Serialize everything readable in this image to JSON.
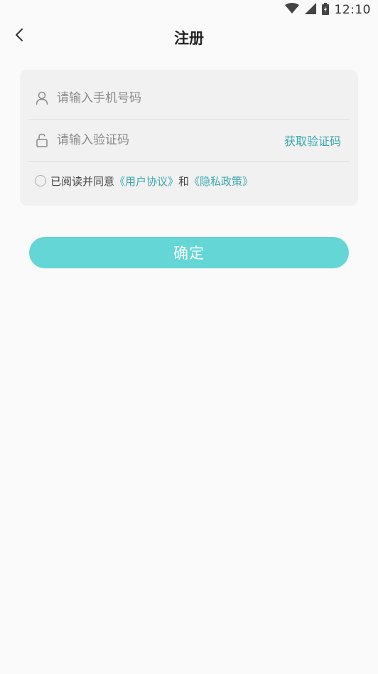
{
  "status_bar": {
    "time": "12:10",
    "icons": [
      "wifi-icon",
      "signal-icon",
      "battery-icon"
    ]
  },
  "header": {
    "title": "注册",
    "back_icon": "chevron-left-icon"
  },
  "form": {
    "phone": {
      "icon": "user-icon",
      "placeholder": "请输入手机号码",
      "value": ""
    },
    "code": {
      "icon": "lock-icon",
      "placeholder": "请输入验证码",
      "value": "",
      "get_code_label": "获取验证码"
    },
    "agreement": {
      "checked": false,
      "prefix": "已阅读并同意",
      "user_agreement": "《用户协议》",
      "conjunction": "和",
      "privacy_policy": "《隐私政策》"
    }
  },
  "confirm_button": {
    "label": "确定"
  },
  "colors": {
    "accent": "#3aa8ae",
    "button": "#63d6d5",
    "background": "#fafafa",
    "card": "#f1f1f1"
  }
}
